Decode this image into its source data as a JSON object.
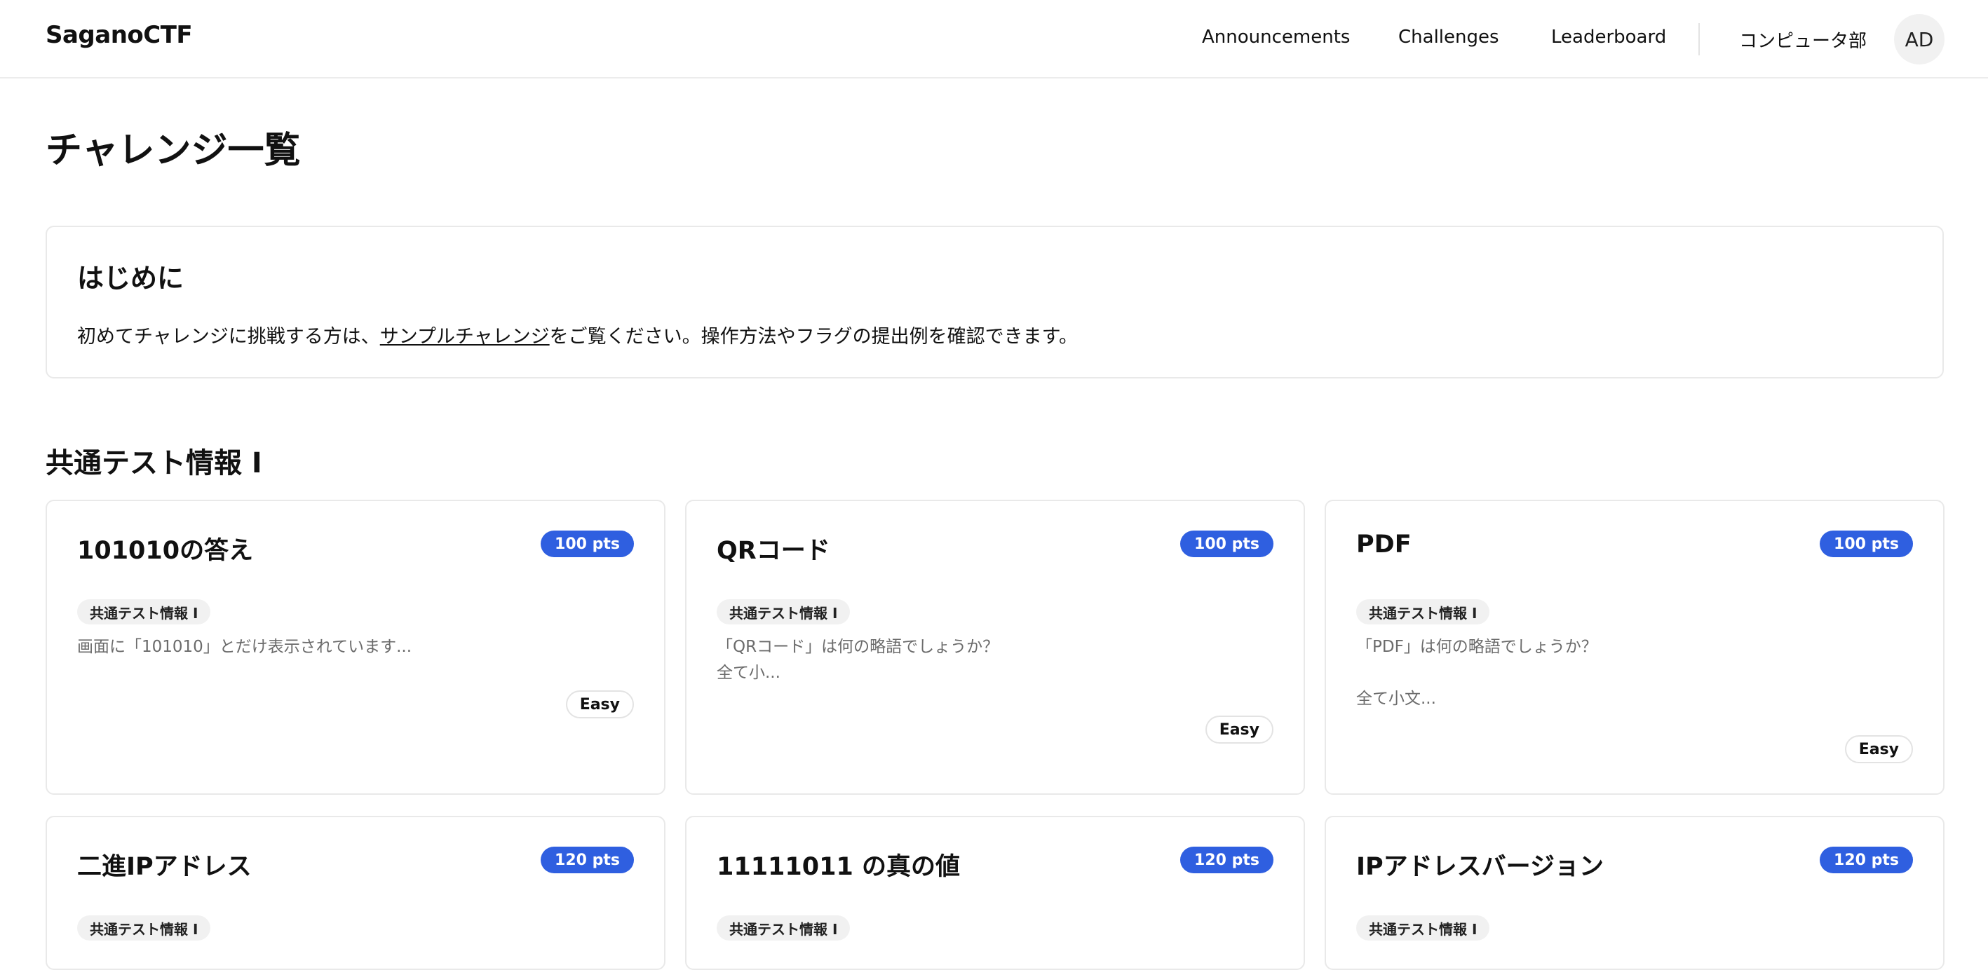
{
  "navbar": {
    "brand": "SaganoCTF",
    "links": [
      "Announcements",
      "Challenges",
      "Leaderboard"
    ],
    "team": "コンピュータ部",
    "avatar": "AD"
  },
  "page_title": "チャレンジ一覧",
  "intro": {
    "title": "はじめに",
    "text_before": "初めてチャレンジに挑戦する方は、",
    "link": "サンプルチャレンジ",
    "text_after": "をご覧ください。操作方法やフラグの提出例を確認できます。"
  },
  "section": {
    "title": "共通テスト情報 I",
    "challenges": [
      {
        "title": "101010の答え",
        "points": "100 pts",
        "tag": "共通テスト情報 I",
        "description": "画面に「101010」とだけ表示されています...",
        "difficulty": "Easy"
      },
      {
        "title": "QRコード",
        "points": "100 pts",
        "tag": "共通テスト情報 I",
        "description": "「QRコード」は何の略語でしょうか？\n全て小...",
        "difficulty": "Easy"
      },
      {
        "title": "PDF",
        "points": "100 pts",
        "tag": "共通テスト情報 I",
        "description": "「PDF」は何の略語でしょうか？\n\n全て小文...",
        "difficulty": "Easy"
      },
      {
        "title": "二進IPアドレス",
        "points": "120 pts",
        "tag": "共通テスト情報 I",
        "description": "",
        "difficulty": ""
      },
      {
        "title": "11111011 の真の値",
        "points": "120 pts",
        "tag": "共通テスト情報 I",
        "description": "",
        "difficulty": ""
      },
      {
        "title": "IPアドレスバージョン",
        "points": "120 pts",
        "tag": "共通テスト情報 I",
        "description": "",
        "difficulty": ""
      }
    ]
  }
}
